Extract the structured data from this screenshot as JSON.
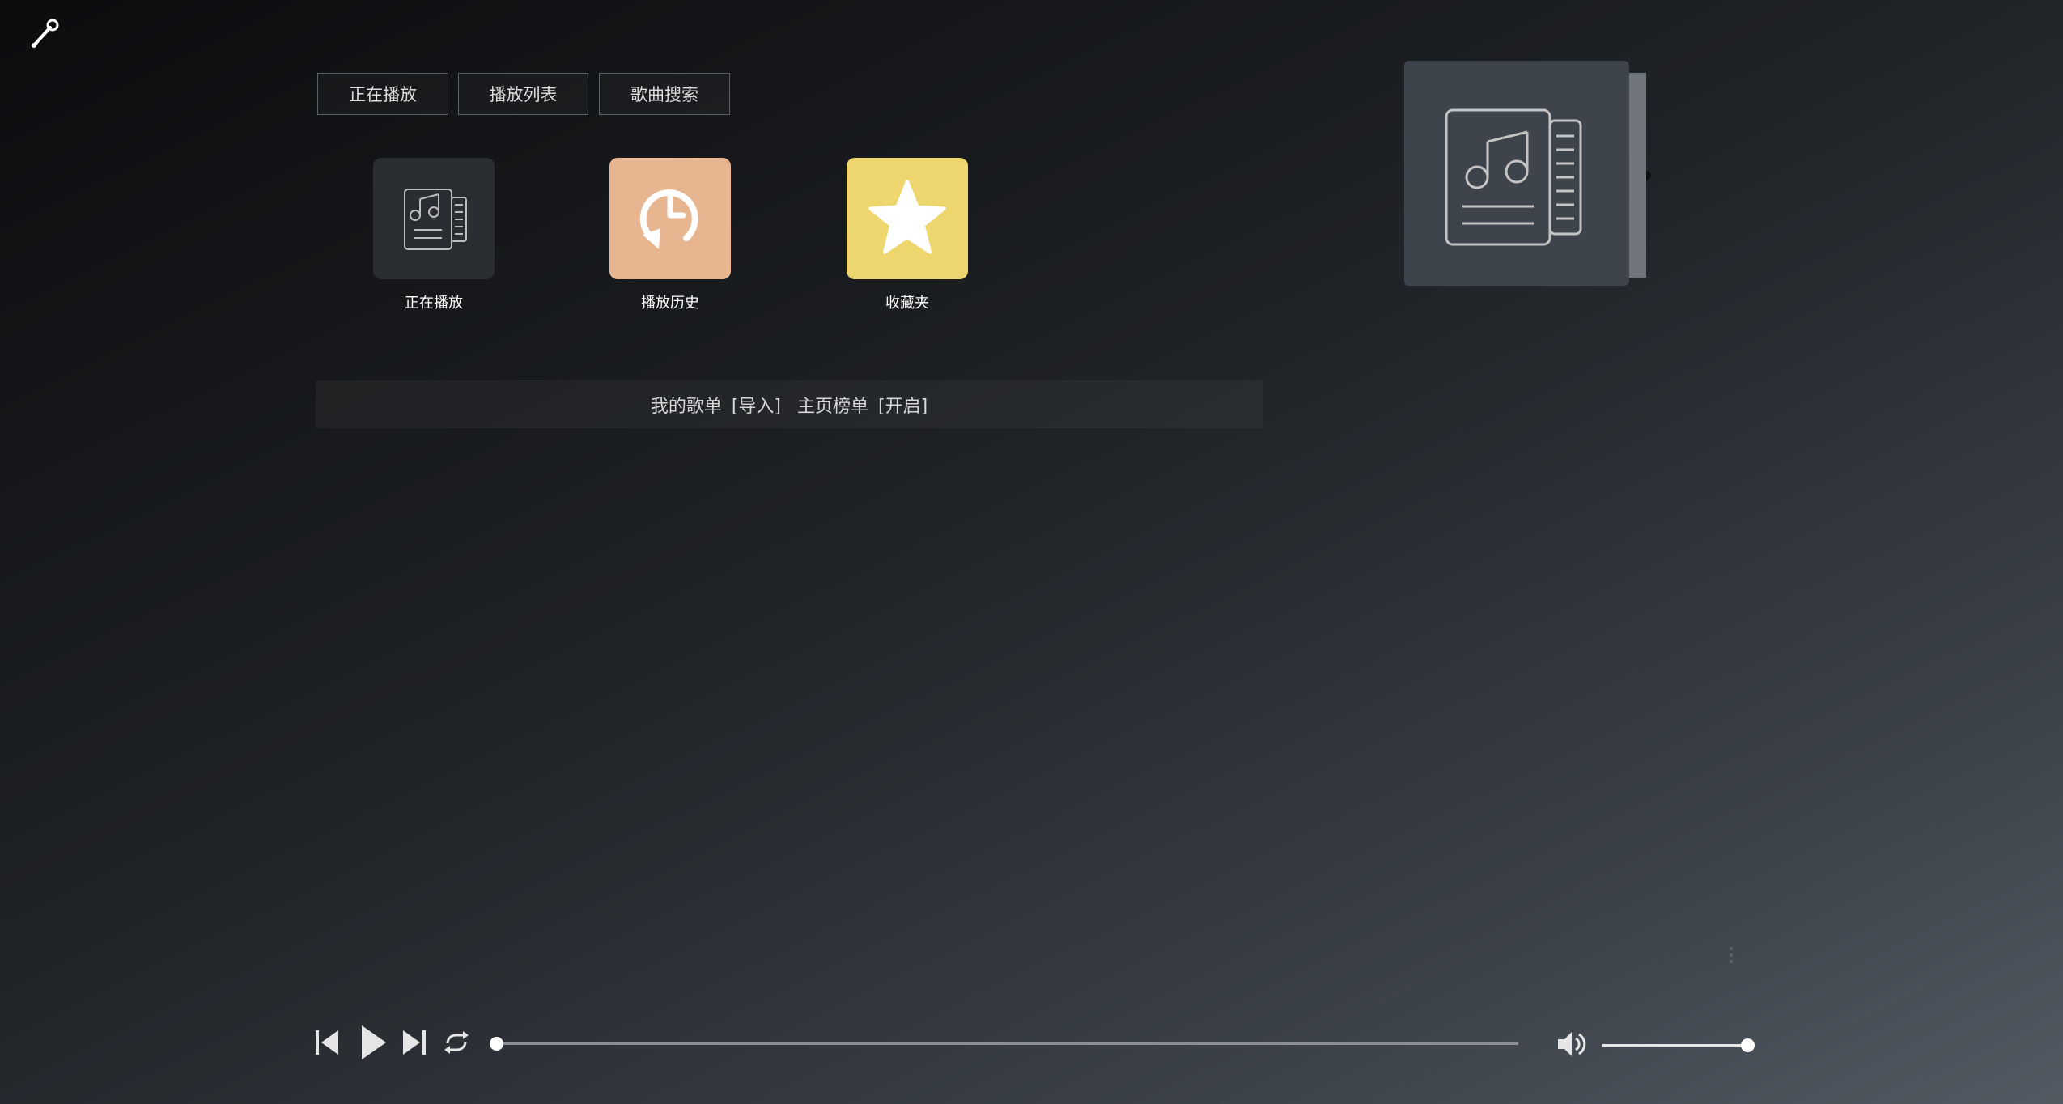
{
  "icons": {
    "settings": "wrench-icon",
    "now_playing": "music-list-icon",
    "history": "history-clock-icon",
    "favorites": "star-icon",
    "album_placeholder": "music-list-icon",
    "more": "vertical-dots-icon",
    "prev": "skip-previous-icon",
    "play": "play-icon",
    "next": "skip-next-icon",
    "loop": "repeat-icon",
    "volume": "volume-icon"
  },
  "tabs": [
    {
      "label": "正在播放"
    },
    {
      "label": "播放列表"
    },
    {
      "label": "歌曲搜索"
    }
  ],
  "shortcuts": [
    {
      "label": "正在播放",
      "color": "#2a2d32"
    },
    {
      "label": "播放历史",
      "color": "#e8b591"
    },
    {
      "label": "收藏夹",
      "color": "#ecd66d"
    }
  ],
  "playlist_bar": {
    "my_playlists": "我的歌单",
    "import": "[导入]",
    "home_charts": "主页榜单",
    "enable": "[开启]"
  },
  "player": {
    "progress": 0,
    "volume": 1.0
  },
  "colors": {
    "accent_history": "#e8b591",
    "accent_favorites": "#ecd66d",
    "track": "#8a8f94"
  }
}
